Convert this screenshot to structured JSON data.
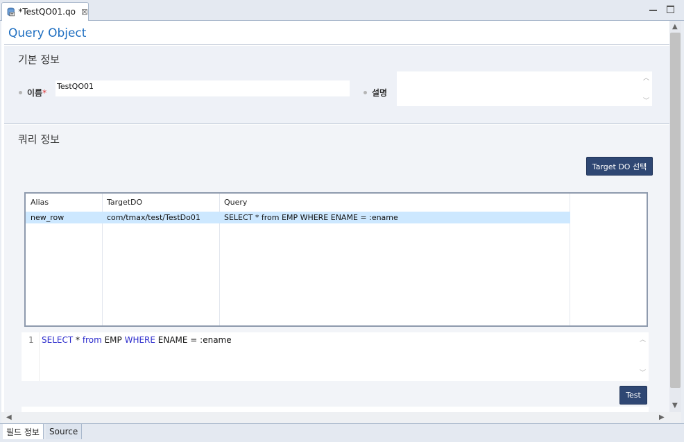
{
  "editor_tab": {
    "label": "*TestQO01.qo",
    "close": "⊠"
  },
  "page_title": "Query Object",
  "basic": {
    "title": "기본 정보",
    "name_label": "이름",
    "required_mark": "*",
    "name_value": "TestQO01",
    "desc_label": "설명",
    "desc_value": ""
  },
  "query": {
    "title": "쿼리 정보",
    "target_button": "Target DO 선택",
    "columns": [
      "Alias",
      "TargetDO",
      "Query"
    ],
    "rows": [
      {
        "alias": "new_row",
        "target": "com/tmax/test/TestDo01",
        "query": "SELECT * from EMP WHERE ENAME = :ename"
      }
    ],
    "editor_line_number": "1",
    "editor_tokens": {
      "select": "SELECT",
      "star": " * ",
      "from": "from",
      "emp": " EMP ",
      "where": "WHERE",
      "rest": " ENAME = :ename"
    },
    "test_button": "Test"
  },
  "page_tabs": [
    "필드 정보",
    "Source"
  ],
  "icons": {
    "up": "▲",
    "down": "▼",
    "left": "◀",
    "right": "▶",
    "mini_up": "︿",
    "mini_down": "﹀"
  },
  "colors": {
    "accent": "#1f6fc1",
    "button": "#2f4773",
    "selection": "#cde8ff",
    "keyword": "#2a2acc"
  }
}
